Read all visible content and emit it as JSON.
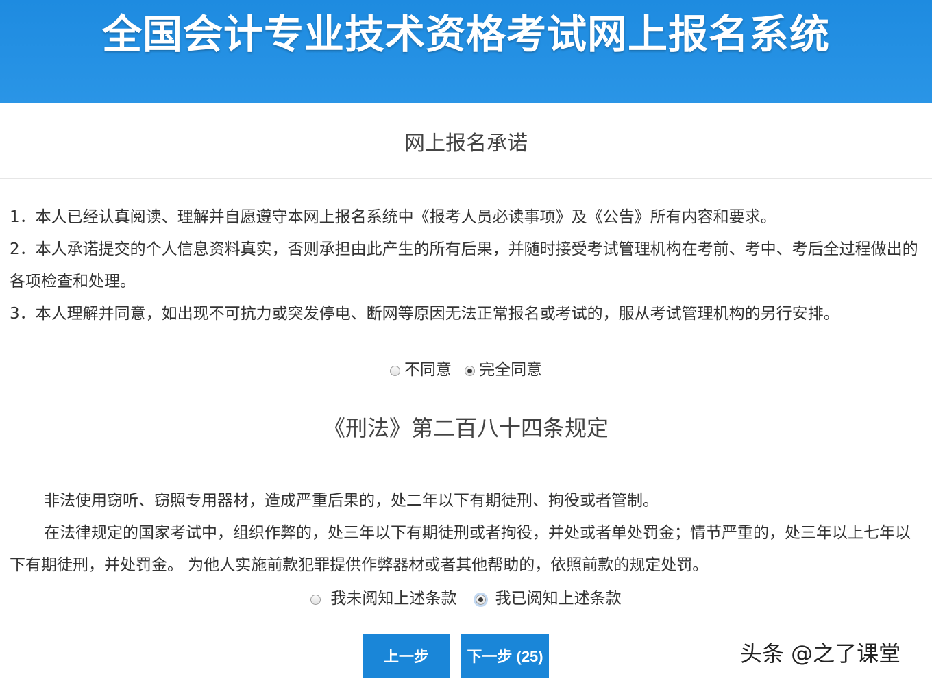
{
  "header": {
    "title": "全国会计专业技术资格考试网上报名系统"
  },
  "pledge": {
    "title": "网上报名承诺",
    "items": [
      "1．本人已经认真阅读、理解并自愿遵守本网上报名系统中《报考人员必读事项》及《公告》所有内容和要求。",
      "2．本人承诺提交的个人信息资料真实，否则承担由此产生的所有后果，并随时接受考试管理机构在考前、考中、考后全过程做出的各项检查和处理。",
      "3．本人理解并同意，如出现不可抗力或突发停电、断网等原因无法正常报名或考试的，服从考试管理机构的另行安排。"
    ],
    "options": [
      {
        "label": "不同意",
        "checked": false
      },
      {
        "label": "完全同意",
        "checked": true
      }
    ]
  },
  "law": {
    "title": "《刑法》第二百八十四条规定",
    "paragraphs": [
      "非法使用窃听、窃照专用器材，造成严重后果的，处二年以下有期徒刑、拘役或者管制。",
      "在法律规定的国家考试中，组织作弊的，处三年以下有期徒刑或者拘役，并处或者单处罚金；情节严重的，处三年以上七年以下有期徒刑，并处罚金。 为他人实施前款犯罪提供作弊器材或者其他帮助的，依照前款的规定处罚。"
    ],
    "options": [
      {
        "label": "我未阅知上述条款",
        "checked": false
      },
      {
        "label": "我已阅知上述条款",
        "checked": true
      }
    ]
  },
  "buttons": {
    "prev": "上一步",
    "next": "下一步 (25)"
  },
  "watermark": "头条 @之了课堂",
  "colors": {
    "header_bg": "#1e8be0",
    "button_bg": "#1a86d8"
  }
}
